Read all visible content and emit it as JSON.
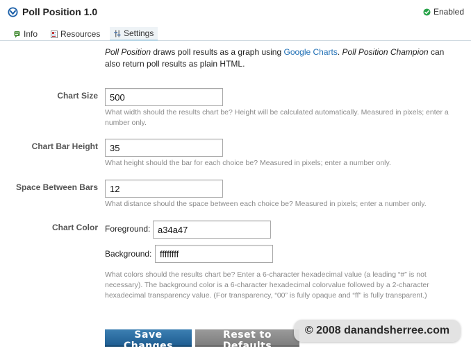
{
  "header": {
    "title": "Poll Position 1.0",
    "status": "Enabled",
    "status_color": "#2aa34a"
  },
  "tabs": [
    {
      "label": "Info",
      "icon": "info-icon"
    },
    {
      "label": "Resources",
      "icon": "resources-icon"
    },
    {
      "label": "Settings",
      "icon": "settings-icon",
      "active": true
    }
  ],
  "intro": {
    "part1": "Poll Position",
    "part2": " draws poll results as a graph using ",
    "link": "Google Charts",
    "part3": ". ",
    "part4": "Poll Position Champion",
    "part5": " can also return poll results as plain HTML."
  },
  "fields": {
    "chart_size": {
      "label": "Chart Size",
      "value": "500",
      "help": "What width should the results chart be? Height will be calculated automatically. Measured in pixels; enter a number only."
    },
    "bar_height": {
      "label": "Chart Bar Height",
      "value": "35",
      "help": "What height should the bar for each choice be? Measured in pixels; enter a number only."
    },
    "bar_space": {
      "label": "Space Between Bars",
      "value": "12",
      "help": "What distance should the space between each choice be? Measured in pixels; enter a number only."
    },
    "chart_color": {
      "label": "Chart Color",
      "foreground_label": "Foreground:",
      "foreground_value": "a34a47",
      "background_label": "Background:",
      "background_value": "ffffffff",
      "help": "What colors should the results chart be? Enter a 6-character hexadecimal value (a leading “#” is not necessary). The background color is a 6-character hexadecimal colorvalue followed by a 2-character hexadecimal transparency value. (For transparency, “00” is fully opaque and “ff” is fully transparent.)"
    }
  },
  "buttons": {
    "save": "Save Changes",
    "reset": "Reset to Defaults"
  },
  "watermark": "© 2008 danandsherree.com",
  "colors": {
    "accent": "#1f5e92",
    "link": "#1f6fb5",
    "help_text": "#8a8a8a"
  }
}
